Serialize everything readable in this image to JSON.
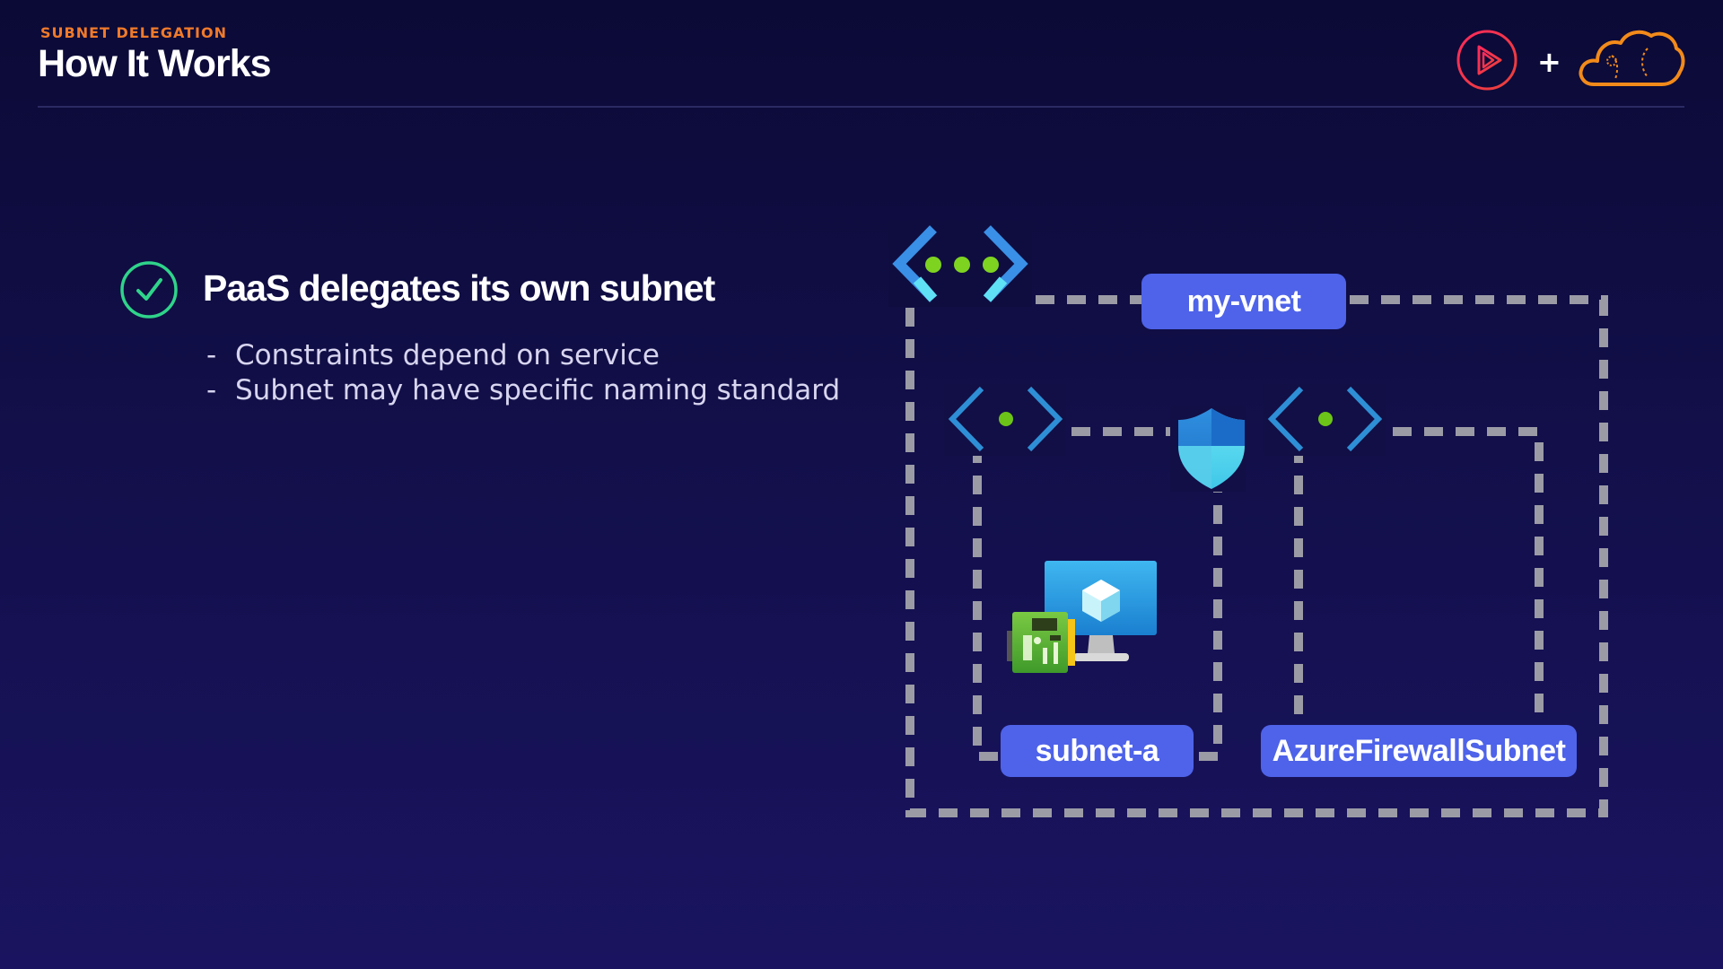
{
  "header": {
    "eyebrow": "SUBNET DELEGATION",
    "title": "How It Works"
  },
  "logos": {
    "plus": "+",
    "left_logo": "play-logo-icon",
    "right_logo": "cloud-logo-icon"
  },
  "point": {
    "heading": "PaaS delegates its own subnet",
    "bullets": [
      {
        "dash": "-",
        "text": "Constraints depend on service"
      },
      {
        "dash": "-",
        "text": "Subnet may have specific naming standard"
      }
    ]
  },
  "diagram": {
    "vnet_label": "my-vnet",
    "subnet_a_label": "subnet-a",
    "firewall_subnet_label": "AzureFirewallSubnet",
    "icons": [
      "vnet-icon",
      "subnet-icon",
      "firewall-shield-icon",
      "virtual-machine-icon",
      "network-interface-icon"
    ]
  },
  "colors": {
    "background": "#120f4a",
    "accent_orange": "#f07a2a",
    "label_blue": "#4e63e9",
    "dashed_border": "#9b9ba6",
    "check_green": "#2fd48a"
  }
}
